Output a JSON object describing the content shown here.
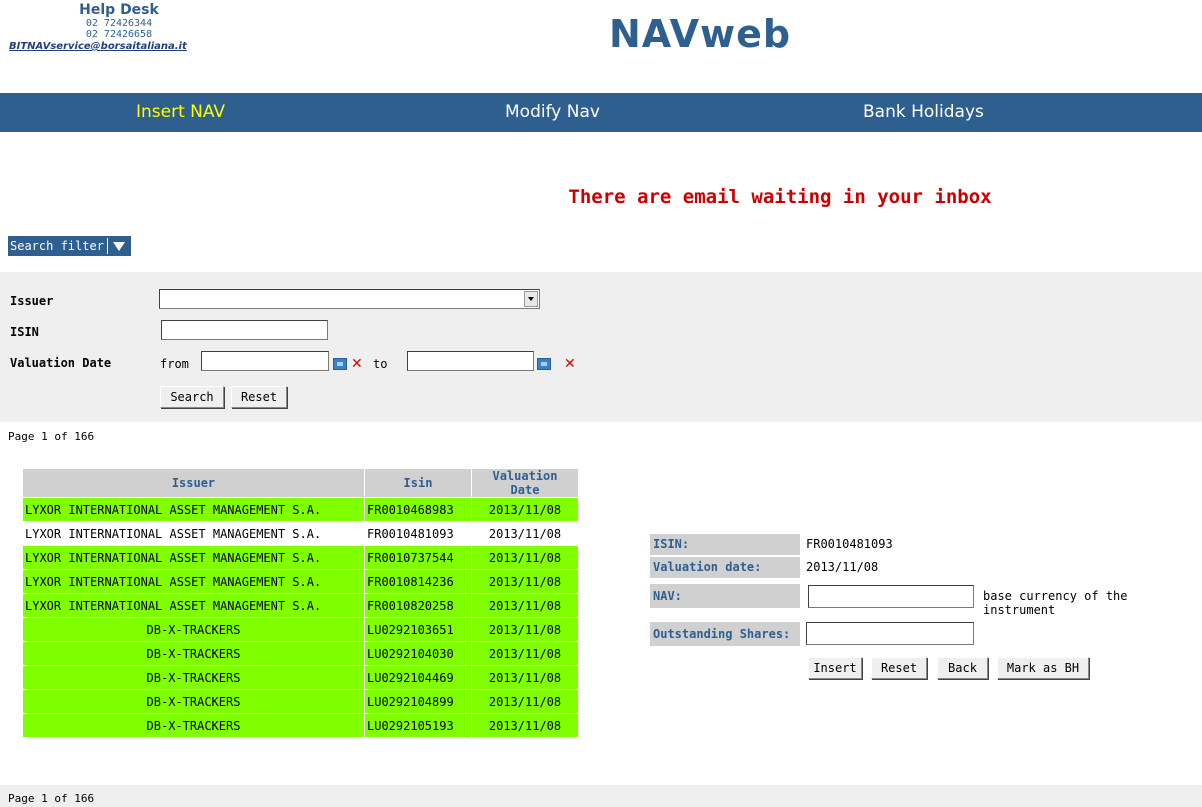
{
  "header": {
    "helpdesk_title": "Help Desk",
    "phone1": "02 72426344",
    "phone2": "02 72426658",
    "email": "BITNAVservice@borsaitaliana.it",
    "app_title": "NAVweb"
  },
  "nav": {
    "items": [
      {
        "label": "Insert NAV",
        "active": true
      },
      {
        "label": "Modify Nav",
        "active": false
      },
      {
        "label": "Bank Holidays",
        "active": false
      }
    ]
  },
  "notice": "There are email waiting in your inbox",
  "search_filter": {
    "toggle_label": "Search filter",
    "issuer_label": "Issuer",
    "issuer_value": "",
    "isin_label": "ISIN",
    "isin_value": "",
    "valuation_date_label": "Valuation Date",
    "from_label": "from",
    "to_label": "to",
    "from_value": "",
    "to_value": "",
    "search_button": "Search",
    "reset_button": "Reset"
  },
  "pagination": {
    "top": "Page 1 of 166",
    "bottom": "Page 1 of 166"
  },
  "results": {
    "headers": [
      "Issuer",
      "Isin",
      "Valuation Date"
    ],
    "rows": [
      {
        "issuer": "LYXOR INTERNATIONAL ASSET MANAGEMENT S.A.",
        "isin": "FR0010468983",
        "date": "2013/11/08",
        "highlight": true
      },
      {
        "issuer": "LYXOR INTERNATIONAL ASSET MANAGEMENT S.A.",
        "isin": "FR0010481093",
        "date": "2013/11/08",
        "highlight": false
      },
      {
        "issuer": "LYXOR INTERNATIONAL ASSET MANAGEMENT S.A.",
        "isin": "FR0010737544",
        "date": "2013/11/08",
        "highlight": true
      },
      {
        "issuer": "LYXOR INTERNATIONAL ASSET MANAGEMENT S.A.",
        "isin": "FR0010814236",
        "date": "2013/11/08",
        "highlight": true
      },
      {
        "issuer": "LYXOR INTERNATIONAL ASSET MANAGEMENT S.A.",
        "isin": "FR0010820258",
        "date": "2013/11/08",
        "highlight": true
      },
      {
        "issuer": "DB-X-TRACKERS",
        "isin": "LU0292103651",
        "date": "2013/11/08",
        "highlight": true
      },
      {
        "issuer": "DB-X-TRACKERS",
        "isin": "LU0292104030",
        "date": "2013/11/08",
        "highlight": true
      },
      {
        "issuer": "DB-X-TRACKERS",
        "isin": "LU0292104469",
        "date": "2013/11/08",
        "highlight": true
      },
      {
        "issuer": "DB-X-TRACKERS",
        "isin": "LU0292104899",
        "date": "2013/11/08",
        "highlight": true
      },
      {
        "issuer": "DB-X-TRACKERS",
        "isin": "LU0292105193",
        "date": "2013/11/08",
        "highlight": true
      }
    ]
  },
  "detail": {
    "isin_label": "ISIN:",
    "isin_value": "FR0010481093",
    "valuation_label": "Valuation date:",
    "valuation_value": "2013/11/08",
    "nav_label": "NAV:",
    "nav_value": "",
    "nav_hint": "base currency of the instrument",
    "shares_label": "Outstanding Shares:",
    "shares_value": "",
    "insert_button": "Insert",
    "reset_button": "Reset",
    "back_button": "Back",
    "mark_bh_button": "Mark as BH"
  },
  "colors": {
    "brand": "#2f5f8f",
    "active_nav": "#ffff00",
    "notice": "#cc0000",
    "row_highlight": "#7fff00"
  },
  "icons": {
    "filter_toggle": "triangle-down-icon",
    "calendar": "calendar-icon",
    "clear": "clear-x-icon",
    "dropdown": "chevron-down-icon"
  }
}
